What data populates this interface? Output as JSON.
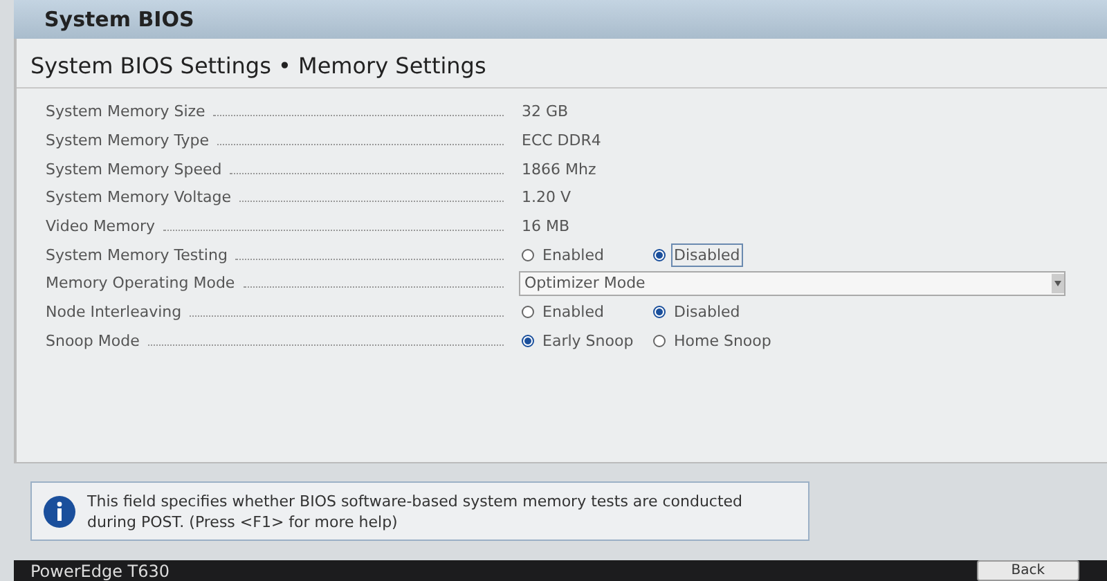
{
  "header": {
    "title": "System BIOS"
  },
  "page": {
    "title": "System BIOS Settings • Memory Settings"
  },
  "settings": [
    {
      "label": "System Memory Size",
      "kind": "text",
      "value": "32 GB"
    },
    {
      "label": "System Memory Type",
      "kind": "text",
      "value": "ECC DDR4"
    },
    {
      "label": "System Memory Speed",
      "kind": "text",
      "value": "1866 Mhz"
    },
    {
      "label": "System Memory Voltage",
      "kind": "text",
      "value": "1.20 V"
    },
    {
      "label": "Video Memory",
      "kind": "text",
      "value": "16 MB"
    },
    {
      "label": "System Memory Testing",
      "kind": "radio",
      "options": [
        {
          "label": "Enabled",
          "selected": false,
          "focused": false
        },
        {
          "label": "Disabled",
          "selected": true,
          "focused": true
        }
      ]
    },
    {
      "label": "Memory Operating Mode",
      "kind": "dropdown",
      "value": "Optimizer Mode"
    },
    {
      "label": "Node Interleaving",
      "kind": "radio",
      "options": [
        {
          "label": "Enabled",
          "selected": false,
          "focused": false
        },
        {
          "label": "Disabled",
          "selected": true,
          "focused": false
        }
      ]
    },
    {
      "label": "Snoop Mode",
      "kind": "radio",
      "options": [
        {
          "label": "Early Snoop",
          "selected": true,
          "focused": false
        },
        {
          "label": "Home Snoop",
          "selected": false,
          "focused": false
        }
      ]
    }
  ],
  "help": {
    "text": "This field specifies whether BIOS software-based system memory tests are conducted during POST. (Press <F1> for more help)"
  },
  "footer": {
    "model": "PowerEdge T630",
    "button": "Back"
  }
}
